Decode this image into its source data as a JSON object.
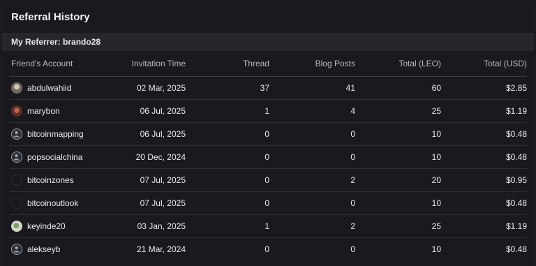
{
  "header": {
    "title": "Referral History"
  },
  "referrer": {
    "text": "My Referrer: brando28"
  },
  "table": {
    "columns": [
      "Friend's Account",
      "Invitation Time",
      "Thread",
      "Blog Posts",
      "Total (LEO)",
      "Total (USD)"
    ],
    "rows": [
      {
        "account": "abdulwahiid",
        "avatar": "photo-avatar",
        "time": "02 Mar, 2025",
        "thread": "37",
        "posts": "41",
        "leo": "60",
        "usd": "$2.85"
      },
      {
        "account": "marybon",
        "avatar": "photo-avatar",
        "time": "06 Jul, 2025",
        "thread": "1",
        "posts": "4",
        "leo": "25",
        "usd": "$1.19"
      },
      {
        "account": "bitcoinmapping",
        "avatar": "default-user-icon",
        "time": "06 Jul, 2025",
        "thread": "0",
        "posts": "0",
        "leo": "10",
        "usd": "$0.48"
      },
      {
        "account": "popsocialchina",
        "avatar": "default-user-icon",
        "time": "20 Dec, 2024",
        "thread": "0",
        "posts": "0",
        "leo": "10",
        "usd": "$0.48"
      },
      {
        "account": "bitcoinzones",
        "avatar": "empty-avatar",
        "time": "07 Jul, 2025",
        "thread": "0",
        "posts": "2",
        "leo": "20",
        "usd": "$0.95"
      },
      {
        "account": "bitcoinoutlook",
        "avatar": "empty-avatar",
        "time": "07 Jul, 2025",
        "thread": "0",
        "posts": "0",
        "leo": "10",
        "usd": "$0.48"
      },
      {
        "account": "keyinde20",
        "avatar": "photo-avatar",
        "time": "03 Jan, 2025",
        "thread": "1",
        "posts": "2",
        "leo": "25",
        "usd": "$1.19"
      },
      {
        "account": "alekseyb",
        "avatar": "default-user-icon",
        "time": "21 Mar, 2024",
        "thread": "0",
        "posts": "0",
        "leo": "10",
        "usd": "$0.48"
      }
    ]
  }
}
